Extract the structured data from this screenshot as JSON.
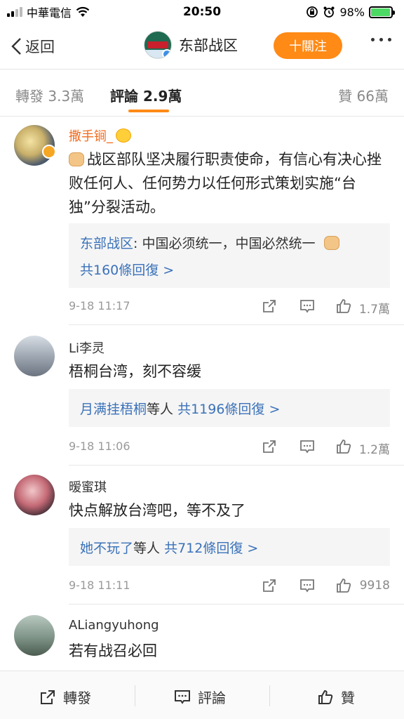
{
  "status_bar": {
    "carrier": "中華電信",
    "time": "20:50",
    "battery": "98%",
    "battery_level": 0.98
  },
  "nav": {
    "back_label": "返回",
    "title": "东部战区",
    "follow_label": "十關注"
  },
  "tabs": [
    {
      "label": "轉發 3.3萬"
    },
    {
      "label": "評論 2.9萬",
      "active": true
    },
    {
      "label": "贊 66萬"
    }
  ],
  "comments": [
    {
      "user": "撒手锏_",
      "text": "战区部队坚决履行职责使命，有信心有决心挫败任何人、任何势力以任何形式策划实施“台独”分裂活动。",
      "reply_preview_user": "东部战区",
      "reply_preview_text": ": 中国必须统一，中国必然统一",
      "reply_count_text": "共160條回復 >",
      "time": "9-18 11:17",
      "likes": "1.7萬"
    },
    {
      "user": "Li李灵",
      "text": "梧桐台湾，刻不容缓",
      "reply_names": "月满挂梧桐",
      "reply_suffix": "等人",
      "reply_count_text": "共1196條回復 >",
      "time": "9-18 11:06",
      "likes": "1.2萬"
    },
    {
      "user": "暧蜜琪",
      "text": "快点解放台湾吧，等不及了",
      "reply_names": "她不玩了",
      "reply_suffix": "等人",
      "reply_count_text": "共712條回復 >",
      "time": "9-18 11:11",
      "likes": "9918"
    },
    {
      "user": "ALiangyuhong",
      "text": "若有战召必回"
    }
  ],
  "toolbar": {
    "repost_label": "轉發",
    "comment_label": "評論",
    "like_label": "贊"
  },
  "colors": {
    "accent": "#ff8a16",
    "link_blue": "#3b72b9",
    "username_orange": "#f26b1d"
  }
}
